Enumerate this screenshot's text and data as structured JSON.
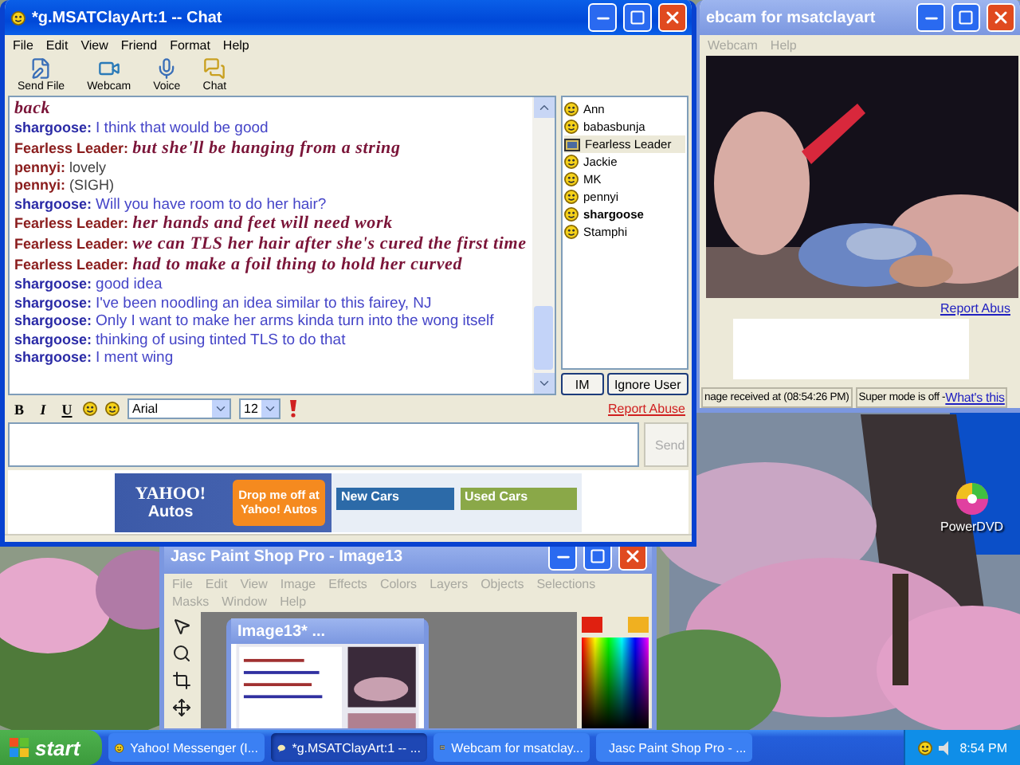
{
  "chat_window": {
    "title": "*g.MSATClayArt:1 -- Chat",
    "active": true,
    "menu": [
      "File",
      "Edit",
      "View",
      "Friend",
      "Format",
      "Help"
    ],
    "toolbar": [
      {
        "label": "Send File",
        "kind": "file"
      },
      {
        "label": "Webcam",
        "kind": "webcam"
      },
      {
        "label": "Voice",
        "kind": "voice"
      },
      {
        "label": "Chat",
        "kind": "chat"
      }
    ],
    "messages": [
      {
        "text": "back",
        "kind": "fancy"
      },
      {
        "sender": "shargoose:",
        "color": "#2a2aa6",
        "text": "I think that would be good",
        "kind": "blue"
      },
      {
        "sender": "Fearless Leader:",
        "color": "#8a1c1c",
        "text": "but she'll be hanging from a string",
        "kind": "fancy"
      },
      {
        "sender": "pennyi:",
        "color": "#8a1c1c",
        "text": "lovely",
        "kind": "plain"
      },
      {
        "sender": "pennyi:",
        "color": "#8a1c1c",
        "text": "(SIGH)",
        "kind": "plain"
      },
      {
        "sender": "shargoose:",
        "color": "#2a2aa6",
        "text": "Will you have room to do her hair?",
        "kind": "blue"
      },
      {
        "sender": "Fearless Leader:",
        "color": "#8a1c1c",
        "text": "her hands and feet will need work",
        "kind": "fancy"
      },
      {
        "sender": "Fearless Leader:",
        "color": "#8a1c1c",
        "text": "we can TLS her hair after she's cured the first time",
        "kind": "fancy"
      },
      {
        "sender": "Fearless Leader:",
        "color": "#8a1c1c",
        "text": "had to make a foil thing to hold her curved",
        "kind": "fancy"
      },
      {
        "sender": "shargoose:",
        "color": "#2a2aa6",
        "text": "good idea",
        "kind": "blue"
      },
      {
        "sender": "shargoose:",
        "color": "#2a2aa6",
        "text": "I've been noodling an idea similar to this fairey, NJ",
        "kind": "blue"
      },
      {
        "sender": "shargoose:",
        "color": "#2a2aa6",
        "text": "Only I want to make her arms kinda turn into the wong itself",
        "kind": "blue"
      },
      {
        "sender": "shargoose:",
        "color": "#2a2aa6",
        "text": "thinking of using tinted TLS to do that",
        "kind": "blue"
      },
      {
        "sender": "shargoose:",
        "color": "#2a2aa6",
        "text": "I ment wing",
        "kind": "blue"
      }
    ],
    "users": [
      {
        "name": "Ann",
        "selected": false,
        "webcam": false,
        "bold": false
      },
      {
        "name": "babasbunja",
        "selected": false,
        "webcam": false,
        "bold": false
      },
      {
        "name": "Fearless Leader",
        "selected": true,
        "webcam": true,
        "bold": false
      },
      {
        "name": "Jackie",
        "selected": false,
        "webcam": false,
        "bold": false
      },
      {
        "name": "MK",
        "selected": false,
        "webcam": false,
        "bold": false
      },
      {
        "name": "pennyi",
        "selected": false,
        "webcam": false,
        "bold": false
      },
      {
        "name": "shargoose",
        "selected": false,
        "webcam": false,
        "bold": true
      },
      {
        "name": "Stamphi",
        "selected": false,
        "webcam": false,
        "bold": false
      }
    ],
    "user_buttons": [
      "IM",
      "Ignore User"
    ],
    "format_buttons": [
      "B",
      "I",
      "U"
    ],
    "font": "Arial",
    "font_size": "12",
    "report_abuse": "Report Abuse",
    "send": "Send",
    "ad": {
      "logo": "YAHOO!",
      "logo_sub": "Autos",
      "cta": "Drop me off at Yahoo! Autos",
      "panels": [
        "New Cars",
        "Used Cars"
      ]
    }
  },
  "webcam_window": {
    "title": "ebcam for msatclayart",
    "active": false,
    "menu": [
      "Webcam",
      "Help"
    ],
    "report_abuse": "Report Abus",
    "status": "nage received at (08:54:26 PM)",
    "super_mode": "Super mode is off - ",
    "link": "What's this"
  },
  "paint_window": {
    "title": "Jasc Paint Shop Pro - Image13",
    "active": false,
    "menu": [
      "File",
      "Edit",
      "View",
      "Image",
      "Effects",
      "Colors",
      "Layers",
      "Objects",
      "Selections",
      "Masks",
      "Window",
      "Help"
    ],
    "image_title": "Image13* ..."
  },
  "desktop_icons": [
    {
      "label": "PowerDVD"
    }
  ],
  "taskbar": {
    "start": "start",
    "tasks": [
      {
        "label": "Yahoo! Messenger (I...",
        "selected": false,
        "kind": "messenger"
      },
      {
        "label": "*g.MSATClayArt:1 -- ...",
        "selected": true,
        "kind": "chat"
      },
      {
        "label": "Webcam for msatclay...",
        "selected": false,
        "kind": "webcam"
      },
      {
        "label": "Jasc Paint Shop Pro - ...",
        "selected": false,
        "kind": "paint"
      }
    ],
    "clock": "8:54 PM"
  }
}
